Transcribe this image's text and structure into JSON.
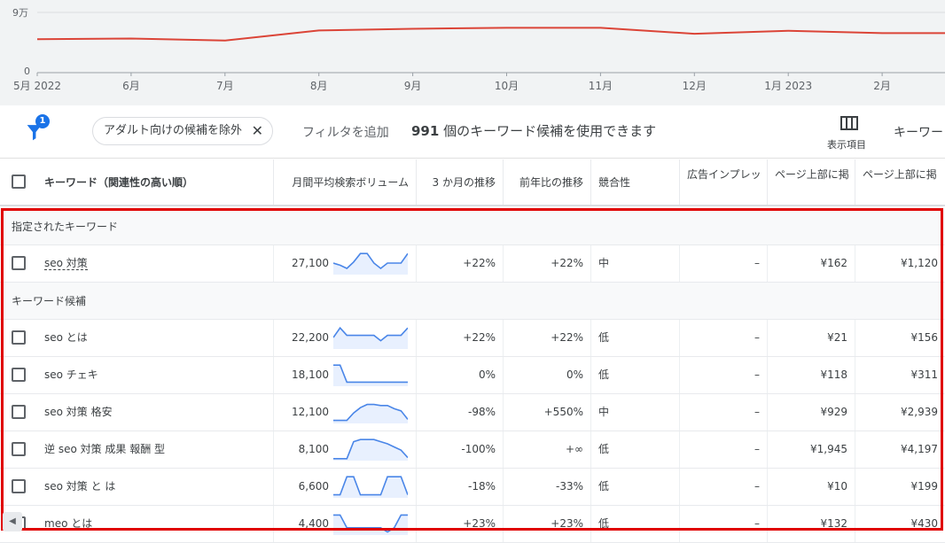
{
  "chart": {
    "y_ticks": [
      "9万",
      "0"
    ],
    "x_ticks": [
      "5月 2022",
      "6月",
      "7月",
      "8月",
      "9月",
      "10月",
      "11月",
      "12月",
      "1月 2023",
      "2月"
    ],
    "line_color": "#db4437"
  },
  "chart_data": {
    "type": "line",
    "title": "",
    "xlabel": "",
    "ylabel": "",
    "ylim": [
      0,
      90000
    ],
    "categories": [
      "5月 2022",
      "6月",
      "7月",
      "8月",
      "9月",
      "10月",
      "11月",
      "12月",
      "1月 2023",
      "2月",
      ""
    ],
    "series": [
      {
        "values": [
          50000,
          51000,
          48000,
          63000,
          65500,
          67000,
          67000,
          58000,
          62500,
          59000,
          59000
        ]
      }
    ],
    "grid": true
  },
  "filters": {
    "badge": "1",
    "chip_label": "アダルト向けの候補を除外",
    "add_filter": "フィルタを追加",
    "count_number": "991",
    "count_text": "個のキーワード候補を使用できます",
    "columns_label": "表示項目",
    "keyword_more": "キーワー"
  },
  "table": {
    "headers": {
      "keyword": "キーワード（関連性の高い順）",
      "volume": "月間平均検索ボリューム",
      "three_month": "3 か月の推移",
      "yoy": "前年比の推移",
      "competition": "競合性",
      "impression_share": "広告インプレッ",
      "top_bid_low": "ページ上部に掲",
      "top_bid_high": "ページ上部に掲"
    },
    "groups": {
      "specified": "指定されたキーワード",
      "candidates": "キーワード候補"
    },
    "specified_rows": [
      {
        "keyword": "seo 対策",
        "volume": "27,100",
        "three_month": "+22%",
        "yoy": "+22%",
        "competition": "中",
        "impression": "–",
        "bid_low": "¥162",
        "bid_high": "¥1,120",
        "trend": [
          0.5,
          0.4,
          0.25,
          0.55,
          0.95,
          0.95,
          0.5,
          0.25,
          0.5,
          0.5,
          0.5,
          0.95
        ]
      }
    ],
    "candidate_rows": [
      {
        "keyword": "seo とは",
        "volume": "22,200",
        "three_month": "+22%",
        "yoy": "+22%",
        "competition": "低",
        "impression": "–",
        "bid_low": "¥21",
        "bid_high": "¥156",
        "trend": [
          0.5,
          0.95,
          0.6,
          0.6,
          0.6,
          0.6,
          0.6,
          0.35,
          0.6,
          0.6,
          0.6,
          0.95
        ]
      },
      {
        "keyword": "seo チェキ",
        "volume": "18,100",
        "three_month": "0%",
        "yoy": "0%",
        "competition": "低",
        "impression": "–",
        "bid_low": "¥118",
        "bid_high": "¥311",
        "trend": [
          0.95,
          0.95,
          0.15,
          0.15,
          0.15,
          0.15,
          0.15,
          0.15,
          0.15,
          0.15,
          0.15,
          0.15
        ]
      },
      {
        "keyword": "seo 対策 格安",
        "volume": "12,100",
        "three_month": "-98%",
        "yoy": "+550%",
        "competition": "中",
        "impression": "–",
        "bid_low": "¥929",
        "bid_high": "¥2,939",
        "trend": [
          0.1,
          0.1,
          0.1,
          0.45,
          0.7,
          0.85,
          0.85,
          0.8,
          0.8,
          0.65,
          0.55,
          0.15
        ]
      },
      {
        "keyword": "逆 seo 対策 成果 報酬 型",
        "volume": "8,100",
        "three_month": "-100%",
        "yoy": "+∞",
        "competition": "低",
        "impression": "–",
        "bid_low": "¥1,945",
        "bid_high": "¥4,197",
        "trend": [
          0.05,
          0.05,
          0.05,
          0.85,
          0.95,
          0.95,
          0.95,
          0.85,
          0.75,
          0.6,
          0.45,
          0.1
        ]
      },
      {
        "keyword": "seo 対策 と は",
        "volume": "6,600",
        "three_month": "-18%",
        "yoy": "-33%",
        "competition": "低",
        "impression": "–",
        "bid_low": "¥10",
        "bid_high": "¥199",
        "trend": [
          0.1,
          0.1,
          0.95,
          0.95,
          0.1,
          0.1,
          0.1,
          0.1,
          0.95,
          0.95,
          0.95,
          0.1
        ]
      },
      {
        "keyword": "meo とは",
        "volume": "4,400",
        "three_month": "+23%",
        "yoy": "+23%",
        "competition": "低",
        "impression": "–",
        "bid_low": "¥132",
        "bid_high": "¥430",
        "trend": [
          0.9,
          0.9,
          0.3,
          0.3,
          0.3,
          0.3,
          0.3,
          0.3,
          0.1,
          0.3,
          0.9,
          0.9
        ]
      }
    ]
  }
}
